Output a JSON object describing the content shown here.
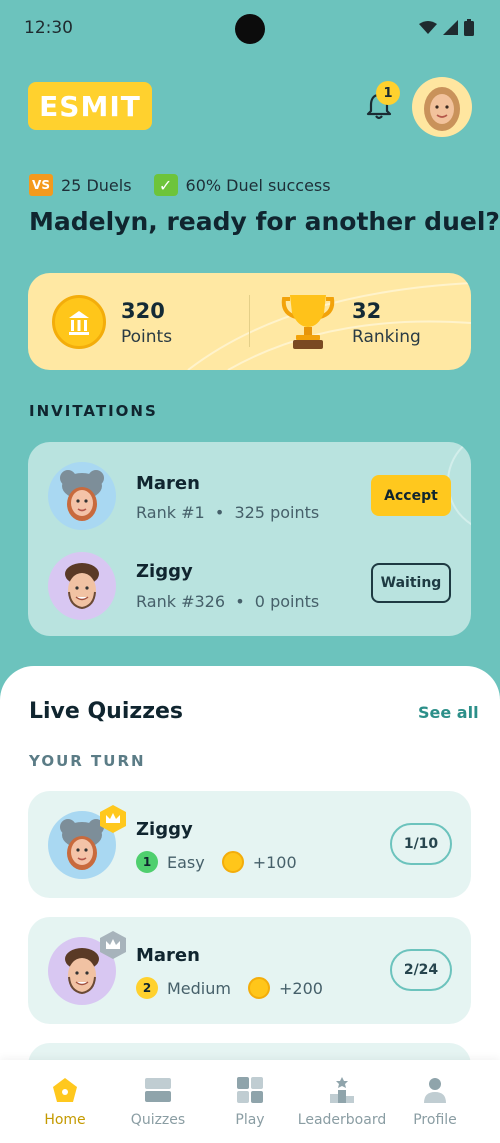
{
  "status": {
    "time": "12:30"
  },
  "header": {
    "logo_text": "ESMIT",
    "notification_count": "1"
  },
  "stats": {
    "duels_badge": "VS",
    "duels": "25 Duels",
    "success": "60% Duel success"
  },
  "greeting": "Madelyn, ready for another duel?",
  "summary": {
    "points_value": "320",
    "points_label": "Points",
    "ranking_value": "32",
    "ranking_label": "Ranking"
  },
  "invitations": {
    "title": "INVITATIONS",
    "items": [
      {
        "name": "Maren",
        "rank": "Rank #1",
        "points": "325 points",
        "action": "Accept"
      },
      {
        "name": "Ziggy",
        "rank": "Rank #326",
        "points": "0 points",
        "action": "Waiting"
      }
    ]
  },
  "live": {
    "title": "Live Quizzes",
    "see_all": "See all",
    "your_turn": "YOUR TURN",
    "quizzes": [
      {
        "name": "Ziggy",
        "level_num": "1",
        "level": "Easy",
        "reward": "+100",
        "progress": "1/10"
      },
      {
        "name": "Maren",
        "level_num": "2",
        "level": "Medium",
        "reward": "+200",
        "progress": "2/24"
      }
    ]
  },
  "tabs": [
    {
      "label": "Home",
      "icon": "home-icon"
    },
    {
      "label": "Quizzes",
      "icon": "quizzes-icon"
    },
    {
      "label": "Play",
      "icon": "play-icon"
    },
    {
      "label": "Leaderboard",
      "icon": "leaderboard-icon"
    },
    {
      "label": "Profile",
      "icon": "profile-icon"
    }
  ],
  "colors": {
    "background": "#6cc3bd",
    "accent": "#ffd12e",
    "card": "#b9e3df",
    "active_tab": "#c49a00"
  }
}
